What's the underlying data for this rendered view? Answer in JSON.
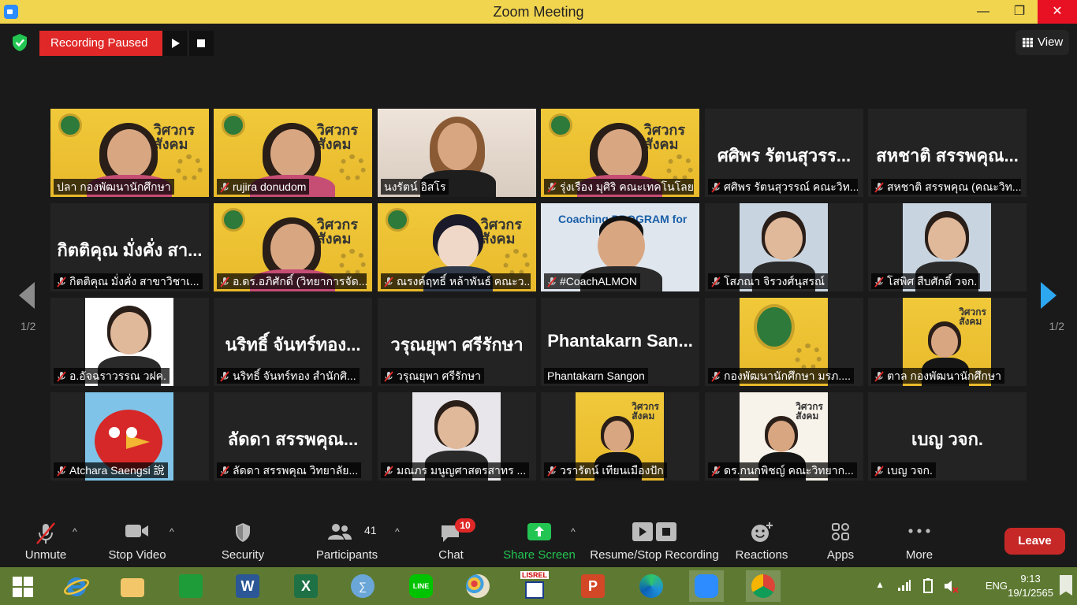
{
  "window": {
    "title": "Zoom Meeting"
  },
  "topbar": {
    "recording_status": "Recording Paused",
    "view_label": "View"
  },
  "gallery": {
    "page_indicator": "1/2",
    "tiles": [
      {
        "name": "ปลา กองพัฒนานักศึกษา",
        "muted": false,
        "kind": "poster-person",
        "active": false
      },
      {
        "name": "rujira donudom",
        "muted": true,
        "kind": "poster-person",
        "active": false
      },
      {
        "name": "นงรัตน์ อิสโร",
        "muted": false,
        "kind": "person",
        "active": true
      },
      {
        "name": "รุ่งเรือง มุศิริ คณะเทคโนโลย...",
        "muted": true,
        "kind": "poster-person",
        "active": false
      },
      {
        "name": "ศศิพร รัตนสุวรรณ์ คณะวิท...",
        "big": "ศศิพร รัตนสุวรร...",
        "muted": true,
        "kind": "name",
        "active": false
      },
      {
        "name": "สหชาติ สรรพคุณ (คณะวิท...",
        "big": "สหชาติ สรรพคุณ...",
        "muted": true,
        "kind": "name",
        "active": false
      },
      {
        "name": "กิตติคุณ มั่งคั่ง สาขาวิชาเ...",
        "big": "กิตติคุณ มั่งคั่ง สา...",
        "muted": true,
        "kind": "name",
        "active": false
      },
      {
        "name": "อ.ดร.อภิศักดิ์ (วิทยาการจัด...",
        "muted": true,
        "kind": "poster-person",
        "active": false
      },
      {
        "name": "ณรงค์ฤทธิ์ หล้าพันธ์ คณะว...",
        "muted": true,
        "kind": "poster-avatar",
        "active": false
      },
      {
        "name": "#CoachALMON",
        "muted": true,
        "kind": "coach",
        "active": false
      },
      {
        "name": "โสภณา จิรวงศ์นุสรณ์",
        "muted": true,
        "kind": "portrait",
        "active": false
      },
      {
        "name": "โสพิศ สืบศักดิ์ วจก.",
        "muted": true,
        "kind": "portrait",
        "active": false
      },
      {
        "name": "อ.อัจฉราวรรณ วฝค.",
        "muted": true,
        "kind": "portrait-white",
        "active": false
      },
      {
        "name": "นริทธิ์ จันทร์ทอง สำนักศิ...",
        "big": "นริทธิ์ จันทร์ทอง...",
        "muted": true,
        "kind": "name",
        "active": false
      },
      {
        "name": "วรุณยุพา ศรีรักษา",
        "big": "วรุณยุพา ศรีรักษา",
        "muted": true,
        "kind": "name",
        "active": false
      },
      {
        "name": "Phantakarn Sangon",
        "big": "Phantakarn San...",
        "muted": false,
        "kind": "name",
        "active": false
      },
      {
        "name": "กองพัฒนานักศึกษา มรภ....",
        "muted": true,
        "kind": "poster-seal",
        "active": false
      },
      {
        "name": "ตาล กองพัฒนานักศึกษา",
        "muted": true,
        "kind": "poster-person-mid",
        "active": false
      },
      {
        "name": "Atchara Saengsi 說",
        "muted": true,
        "kind": "bird",
        "active": false
      },
      {
        "name": "ลัดดา สรรพคุณ วิทยาลัย...",
        "big": "ลัดดา สรรพคุณ...",
        "muted": true,
        "kind": "name",
        "active": false
      },
      {
        "name": "มณภร มนูญศาสตรสาทร ...",
        "muted": true,
        "kind": "portrait-office",
        "active": false
      },
      {
        "name": "วรารัตน์ เทียนเมืองปัก",
        "muted": true,
        "kind": "poster-person-mid",
        "active": false
      },
      {
        "name": "ดร.กนกพิชญ์ คณะวิทยาก...",
        "muted": true,
        "kind": "poster-person-mid-white",
        "active": false
      },
      {
        "name": "เบญ วจก.",
        "big": "เบญ วจก.",
        "muted": true,
        "kind": "name",
        "active": false
      }
    ],
    "poster_text": "วิศวกร\nสังคม",
    "coach_banner": "Coaching PROGRAM for"
  },
  "toolbar": {
    "unmute": "Unmute",
    "stop_video": "Stop Video",
    "security": "Security",
    "participants": "Participants",
    "participants_count": "41",
    "chat": "Chat",
    "chat_badge": "10",
    "share_screen": "Share Screen",
    "recording": "Resume/Stop Recording",
    "reactions": "Reactions",
    "apps": "Apps",
    "more": "More",
    "leave": "Leave"
  },
  "taskbar": {
    "apps": [
      "start",
      "internet-explorer",
      "file-explorer",
      "store",
      "word",
      "excel",
      "math-input",
      "line",
      "paint",
      "lisrel",
      "powerpoint",
      "edge",
      "zoom",
      "chrome"
    ],
    "lisrel_label": "LISREL",
    "language": "ENG",
    "time": "9:13",
    "date": "19/1/2565"
  },
  "colors": {
    "title_bar": "#f2d54f",
    "recording_red": "#e02828",
    "active_speaker": "#c6e234",
    "share_green": "#23c552",
    "taskbar": "#5e7a32"
  }
}
